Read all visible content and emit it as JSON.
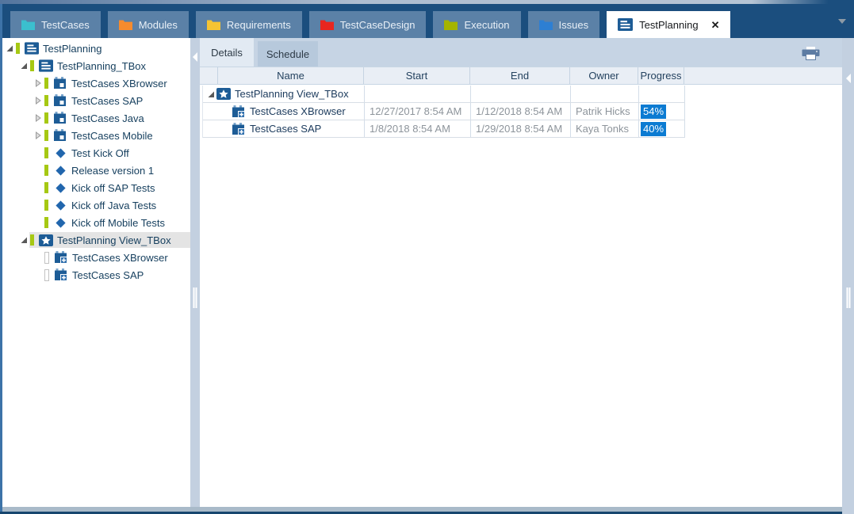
{
  "colors": {
    "navy": "#1b4e7e",
    "tab_inactive": "#5b81a7",
    "icon_blue": "#1d5c96",
    "diamond_blue": "#2166ad",
    "tree_green": "#a6c813",
    "selection_gray": "#e4e4e4",
    "progress_bg": "#0c7bd2"
  },
  "icons": {
    "close": "✕",
    "dropdown_arrow": "chevron-down",
    "collapse_arrow": "chevron-left",
    "printer": "printer"
  },
  "main_tabs": [
    {
      "label": "TestCases",
      "icon": "folder-icon",
      "icon_color": "#3bbfce",
      "active": false
    },
    {
      "label": "Modules",
      "icon": "folder-icon",
      "icon_color": "#f68b2e",
      "active": false
    },
    {
      "label": "Requirements",
      "icon": "folder-icon",
      "icon_color": "#f5c433",
      "active": false
    },
    {
      "label": "TestCaseDesign",
      "icon": "folder-icon",
      "icon_color": "#e8261f",
      "active": false
    },
    {
      "label": "Execution",
      "icon": "folder-icon",
      "icon_color": "#a4b400",
      "active": false
    },
    {
      "label": "Issues",
      "icon": "folder-icon",
      "icon_color": "#2d7fd3",
      "active": false
    },
    {
      "label": "TestPlanning",
      "icon": "list-icon",
      "icon_color": "#1d5c96",
      "active": true,
      "close_label": "✕"
    }
  ],
  "tree": [
    {
      "label": "TestPlanning",
      "level": 0,
      "expander": "expanded",
      "bar": "green",
      "icon": "list",
      "selected": false
    },
    {
      "label": "TestPlanning_TBox",
      "level": 1,
      "expander": "expanded",
      "bar": "green",
      "icon": "list",
      "selected": false
    },
    {
      "label": "TestCases XBrowser",
      "level": 2,
      "expander": "collapsed",
      "bar": "green",
      "icon": "calendar",
      "selected": false
    },
    {
      "label": "TestCases SAP",
      "level": 2,
      "expander": "collapsed",
      "bar": "green",
      "icon": "calendar",
      "selected": false
    },
    {
      "label": "TestCases Java",
      "level": 2,
      "expander": "collapsed",
      "bar": "green",
      "icon": "calendar",
      "selected": false
    },
    {
      "label": "TestCases Mobile",
      "level": 2,
      "expander": "collapsed",
      "bar": "green",
      "icon": "calendar",
      "selected": false
    },
    {
      "label": "Test Kick Off",
      "level": 2,
      "expander": "none",
      "bar": "green",
      "icon": "diamond",
      "selected": false
    },
    {
      "label": "Release version 1",
      "level": 2,
      "expander": "none",
      "bar": "green",
      "icon": "diamond",
      "selected": false
    },
    {
      "label": "Kick off SAP Tests",
      "level": 2,
      "expander": "none",
      "bar": "green",
      "icon": "diamond",
      "selected": false
    },
    {
      "label": "Kick off Java Tests",
      "level": 2,
      "expander": "none",
      "bar": "green",
      "icon": "diamond",
      "selected": false
    },
    {
      "label": "Kick off Mobile Tests",
      "level": 2,
      "expander": "none",
      "bar": "green",
      "icon": "diamond",
      "selected": false
    },
    {
      "label": "TestPlanning View_TBox",
      "level": 1,
      "expander": "expanded",
      "bar": "green",
      "icon": "star",
      "selected": true
    },
    {
      "label": "TestCases XBrowser",
      "level": 2,
      "expander": "none",
      "bar": "hollow",
      "icon": "calendar-plus",
      "selected": false
    },
    {
      "label": "TestCases SAP",
      "level": 2,
      "expander": "none",
      "bar": "hollow",
      "icon": "calendar-plus",
      "selected": false
    }
  ],
  "detail_tabs": [
    {
      "label": "Details",
      "active": true
    },
    {
      "label": "Schedule",
      "active": false
    }
  ],
  "table": {
    "columns": [
      "Name",
      "Start",
      "End",
      "Owner",
      "Progress"
    ],
    "rows": [
      {
        "name": "TestPlanning View_TBox",
        "level": 0,
        "expander": "expanded",
        "icon": "star",
        "start": "",
        "end": "",
        "owner": "",
        "progress": ""
      },
      {
        "name": "TestCases XBrowser",
        "level": 1,
        "expander": "none",
        "icon": "calendar-plus",
        "start": "12/27/2017 8:54 AM",
        "end": "1/12/2018 8:54 AM",
        "owner": "Patrik Hicks",
        "progress": "54%"
      },
      {
        "name": "TestCases SAP",
        "level": 1,
        "expander": "none",
        "icon": "calendar-plus",
        "start": "1/8/2018 8:54 AM",
        "end": "1/29/2018 8:54 AM",
        "owner": "Kaya Tonks",
        "progress": "40%"
      }
    ]
  }
}
